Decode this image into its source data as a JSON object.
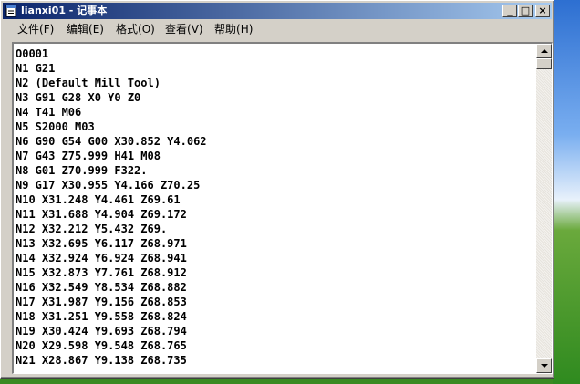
{
  "window": {
    "title": "lianxi01 - 记事本",
    "minimize_label": "_",
    "maximize_label": "□",
    "close_label": "×"
  },
  "menu": [
    {
      "label": "文件",
      "accel": "(F)"
    },
    {
      "label": "编辑",
      "accel": "(E)"
    },
    {
      "label": "格式",
      "accel": "(O)"
    },
    {
      "label": "查看",
      "accel": "(V)"
    },
    {
      "label": "帮助",
      "accel": "(H)"
    }
  ],
  "document": {
    "lines": [
      "O0001",
      "N1 G21",
      "N2 (Default Mill Tool)",
      "N3 G91 G28 X0 Y0 Z0",
      "N4 T41 M06",
      "N5 S2000 M03",
      "N6 G90 G54 G00 X30.852 Y4.062",
      "N7 G43 Z75.999 H41 M08",
      "N8 G01 Z70.999 F322.",
      "N9 G17 X30.955 Y4.166 Z70.25",
      "N10 X31.248 Y4.461 Z69.61",
      "N11 X31.688 Y4.904 Z69.172",
      "N12 X32.212 Y5.432 Z69.",
      "N13 X32.695 Y6.117 Z68.971",
      "N14 X32.924 Y6.924 Z68.941",
      "N15 X32.873 Y7.761 Z68.912",
      "N16 X32.549 Y8.534 Z68.882",
      "N17 X31.987 Y9.156 Z68.853",
      "N18 X31.251 Y9.558 Z68.824",
      "N19 X30.424 Y9.693 Z68.794",
      "N20 X29.598 Y9.548 Z68.765",
      "N21 X28.867 Y9.138 Z68.735"
    ]
  },
  "colors": {
    "titlebar_start": "#0a246a",
    "titlebar_end": "#a6caf0",
    "chrome": "#d4d0c8"
  },
  "icons": {
    "app": "notepad-icon"
  }
}
